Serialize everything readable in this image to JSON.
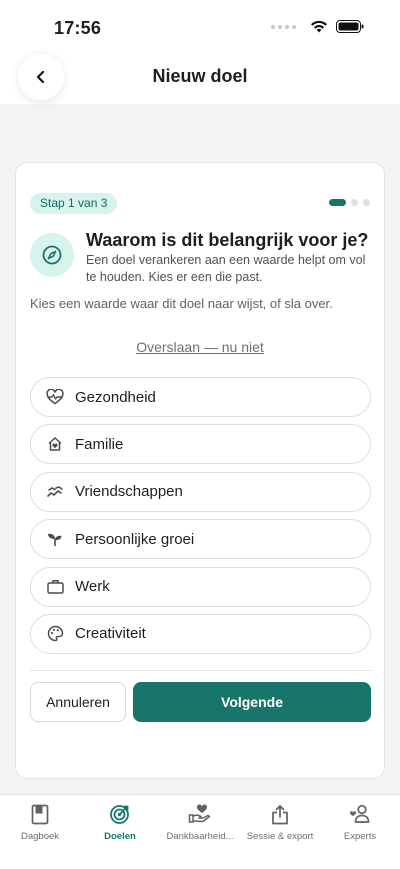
{
  "status_bar": {
    "time": "17:56"
  },
  "header": {
    "title": "Nieuw doel"
  },
  "card": {
    "step_badge": "Stap 1 van 3",
    "progress": {
      "current": 1,
      "total": 3
    },
    "title": "Waarom is dit belangrijk voor je?",
    "subtitle": "Een doel verankeren aan een waarde helpt om vol te houden. Kies er een die past.",
    "instruction": "Kies een waarde waar dit doel naar wijst, of sla over.",
    "skip_link": "Overslaan — nu niet",
    "options": [
      {
        "label": "Gezondheid",
        "icon": "heartbeat-icon"
      },
      {
        "label": "Familie",
        "icon": "home-icon"
      },
      {
        "label": "Vriendschappen",
        "icon": "handshake-icon"
      },
      {
        "label": "Persoonlijke groei",
        "icon": "sprout-icon"
      },
      {
        "label": "Werk",
        "icon": "briefcase-icon"
      },
      {
        "label": "Creativiteit",
        "icon": "palette-icon"
      }
    ],
    "cancel_label": "Annuleren",
    "next_label": "Volgende"
  },
  "tab_bar": {
    "tabs": [
      {
        "label": "Dagboek",
        "icon": "book-icon",
        "active": false
      },
      {
        "label": "Doelen",
        "icon": "target-icon",
        "active": true
      },
      {
        "label": "Dankbaarheid...",
        "icon": "hand-heart-icon",
        "active": false
      },
      {
        "label": "Sessie & export",
        "icon": "share-icon",
        "active": false
      },
      {
        "label": "Experts",
        "icon": "people-icon",
        "active": false
      }
    ]
  },
  "colors": {
    "accent": "#17756a",
    "badge_bg": "#d6f3ec",
    "background": "#f3f4f3"
  }
}
